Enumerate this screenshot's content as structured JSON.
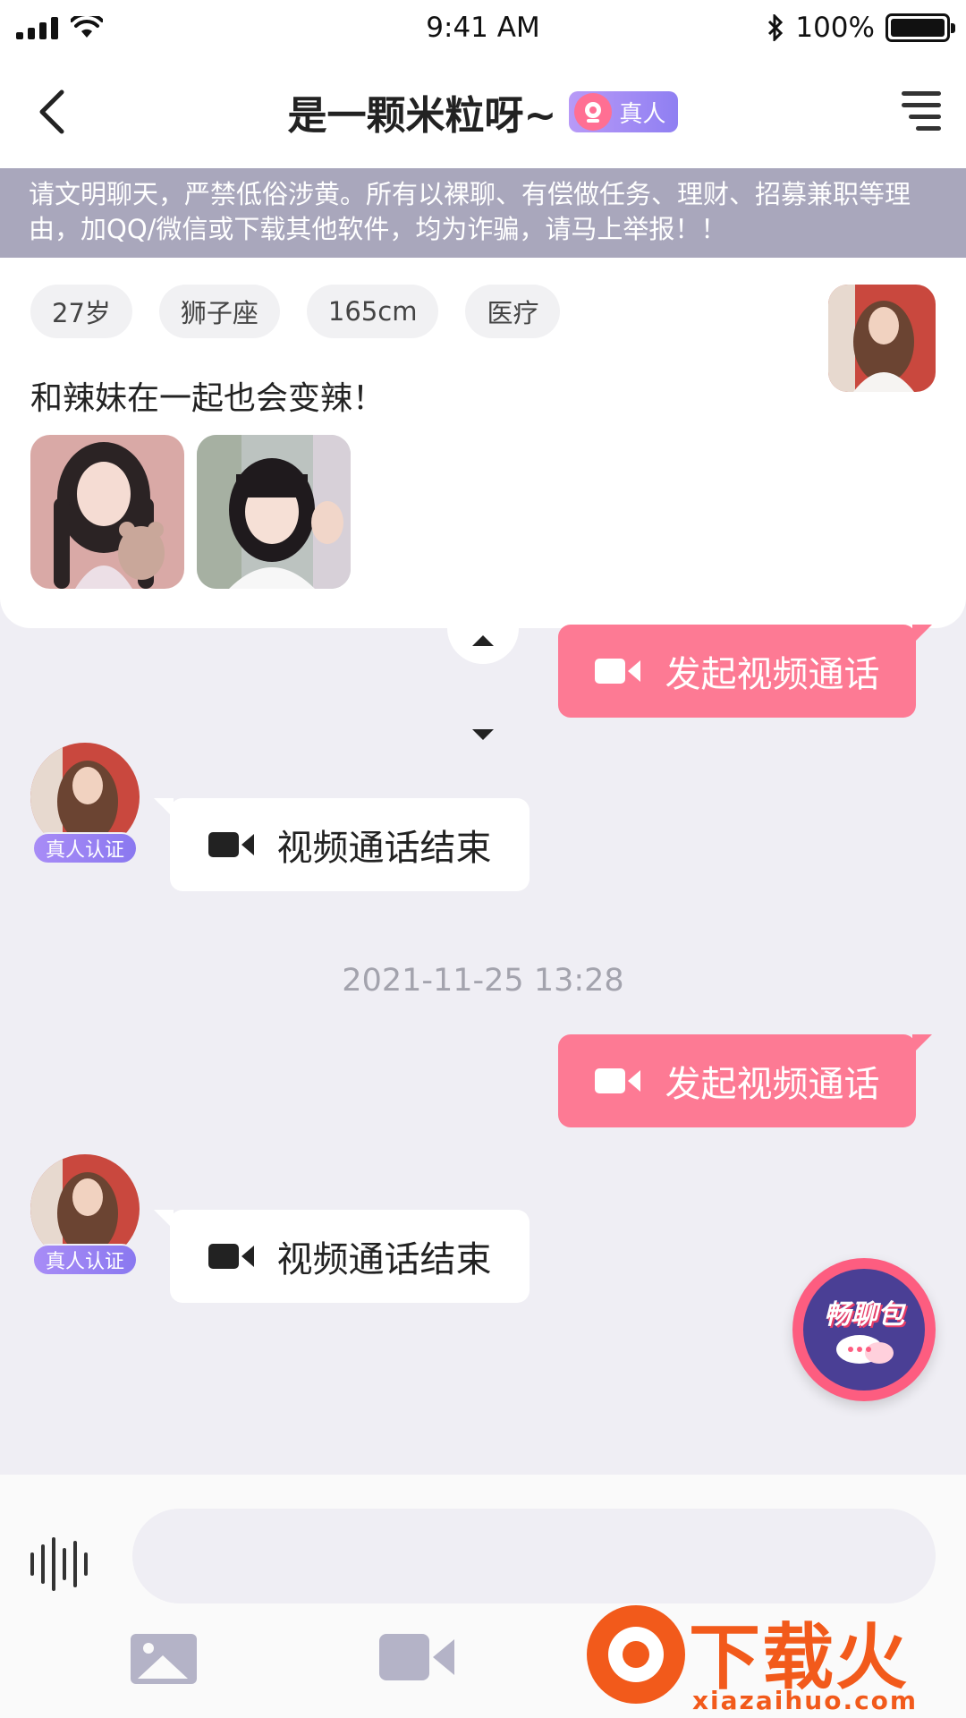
{
  "status_bar": {
    "time": "9:41 AM",
    "battery": "100%",
    "battery_level": 1.0
  },
  "header": {
    "title": "是一颗米粒呀~",
    "verified_label": "真人"
  },
  "warning": "请文明聊天，严禁低俗涉黄。所有以裸聊、有偿做任务、理财、招募兼职等理由，加QQ/微信或下载其他软件，均为诈骗，请马上举报！！",
  "profile": {
    "tags": [
      "27岁",
      "狮子座",
      "165cm",
      "医疗"
    ],
    "bio": "和辣妹在一起也会变辣！",
    "photo_count": 2
  },
  "messages": [
    {
      "side": "out",
      "text": "发起视频通话",
      "icon": "video-camera-icon"
    },
    {
      "side": "in",
      "text": "视频通话结束",
      "icon": "video-camera-icon",
      "badge": "真人认证"
    },
    {
      "timestamp": "2021-11-25 13:28"
    },
    {
      "side": "out",
      "text": "发起视频通话",
      "icon": "video-camera-icon"
    },
    {
      "side": "in",
      "text": "视频通话结束",
      "icon": "video-camera-icon",
      "badge": "真人认证"
    }
  ],
  "floating_button": {
    "label": "畅聊包"
  },
  "input": {
    "value": "",
    "placeholder": ""
  },
  "watermark": {
    "brand": "下载火",
    "url": "xiazaihuo.com"
  },
  "colors": {
    "accent_pink": "#fd7a94",
    "verified_purple": "#8f7ff2",
    "banner_gray": "#a9a7bc",
    "background": "#efeef4"
  }
}
